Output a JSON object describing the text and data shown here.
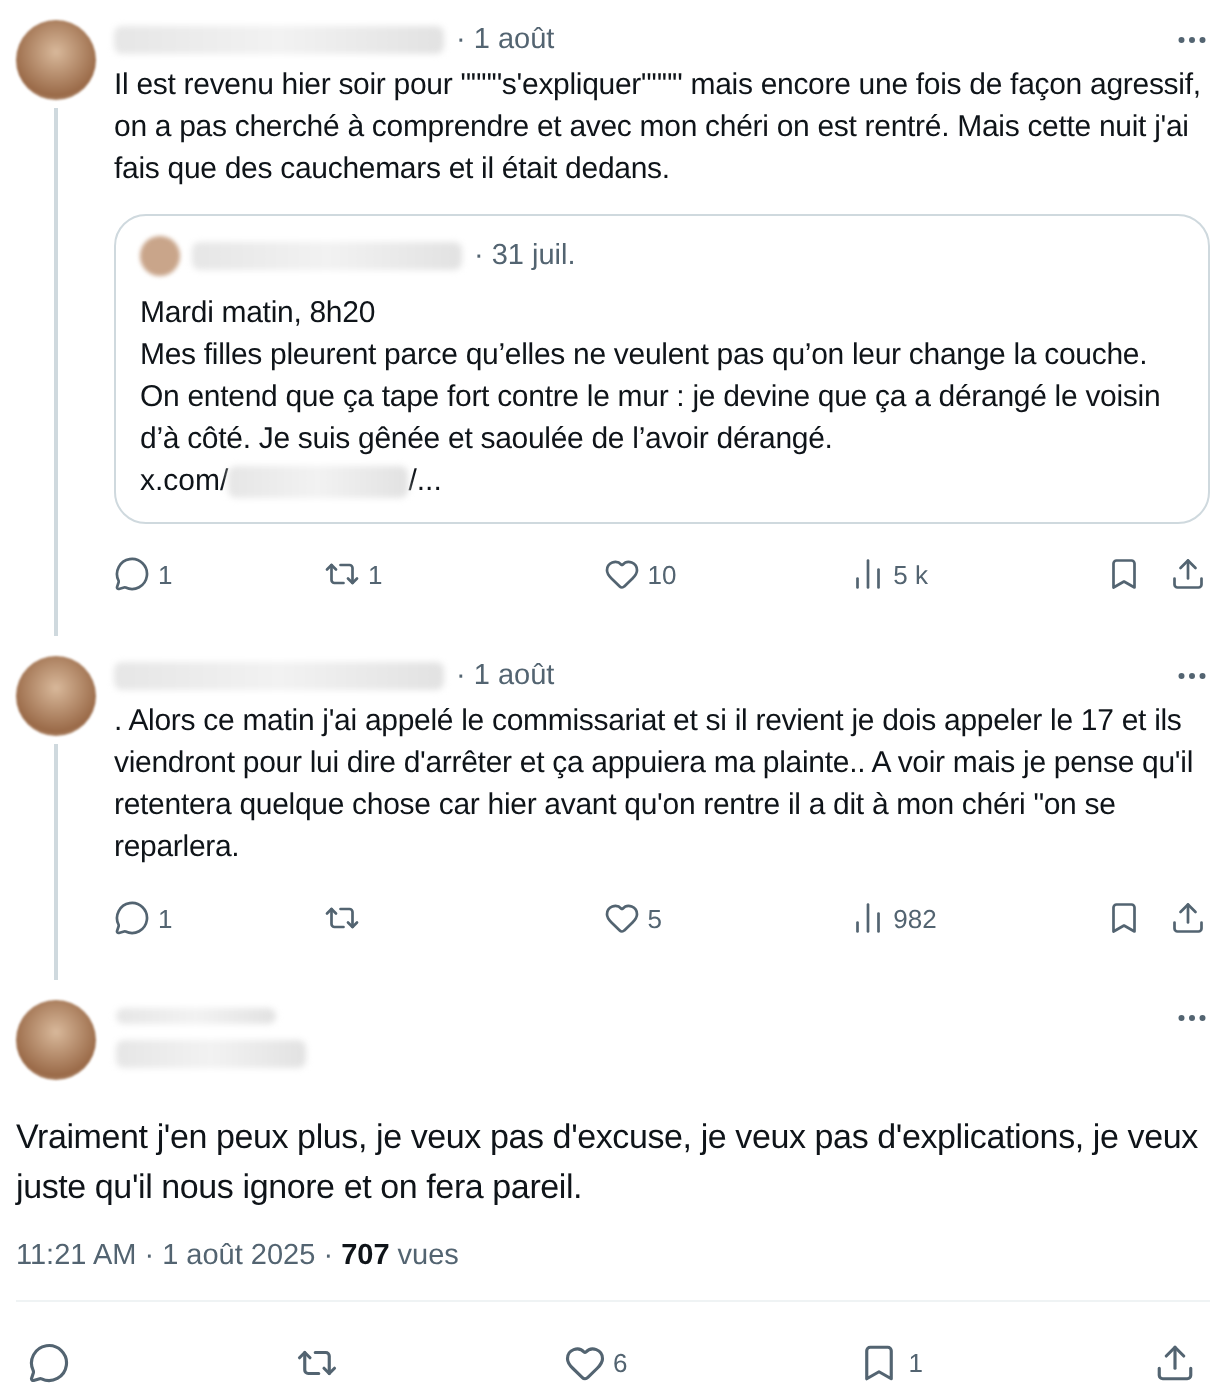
{
  "thread": [
    {
      "date": "· 1 août",
      "text": "Il est revenu hier soir pour \"\"\"\"s'expliquer\"\"\"\" mais encore une fois de façon agressif, on a pas cherché à comprendre et avec mon chéri on est rentré. Mais cette nuit j'ai fais que des cauchemars et il était dedans.",
      "quote": {
        "date": "· 31 juil.",
        "lines": [
          "Mardi matin, 8h20",
          "Mes filles pleurent parce qu’elles ne veulent pas qu’on leur change la couche. On entend que ça tape fort contre le mur : je devine que ça a dérangé le voisin d’à côté. Je suis gênée et saoulée de l’avoir dérangé."
        ],
        "link_start": "x.com/",
        "link_end": "/..."
      },
      "actions": {
        "replies": "1",
        "reposts": "1",
        "likes": "10",
        "views": "5 k"
      }
    },
    {
      "date": "· 1 août",
      "text": ". Alors ce matin j'ai appelé le commissariat et si il revient je dois appeler le 17 et ils viendront pour lui dire d'arrêter et ça appuiera ma plainte.. A voir mais je pense qu'il retentera quelque chose car hier avant qu'on rentre il a dit à mon chéri \"on se reparlera.",
      "actions": {
        "replies": "1",
        "likes": "5",
        "views": "982"
      }
    }
  ],
  "main_post": {
    "text": "Vraiment j'en peux plus, je veux pas d'excuse, je veux pas d'explications, je veux juste qu'il nous ignore et on fera pareil.",
    "meta": "11:21 AM · 1 août 2025 · **707** vues",
    "actions": {
      "likes": "6",
      "bookmarks": "1"
    }
  }
}
